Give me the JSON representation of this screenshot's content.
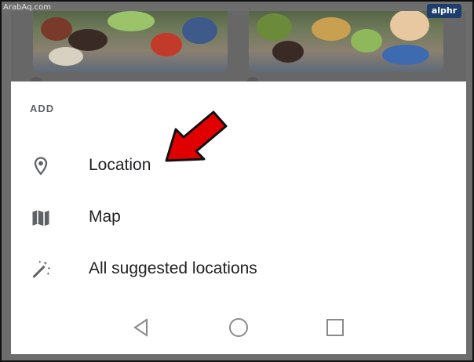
{
  "watermark": "ArabAq.com",
  "badge": "alphr",
  "sheet": {
    "section_label": "ADD",
    "items": [
      {
        "label": "Location",
        "icon": "location-pin-icon"
      },
      {
        "label": "Map",
        "icon": "map-icon"
      },
      {
        "label": "All suggested locations",
        "icon": "magic-wand-icon"
      }
    ]
  },
  "navbar": {
    "icons": [
      "back-triangle-icon",
      "home-circle-icon",
      "recents-square-icon"
    ]
  },
  "colors": {
    "arrow": "#e00000",
    "sheet_background": "#ffffff",
    "scrim": "#676767",
    "badge": "#1d3d6b"
  }
}
